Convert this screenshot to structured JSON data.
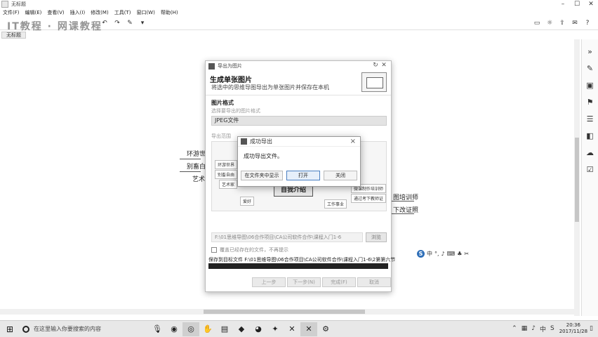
{
  "window": {
    "title": "无标题",
    "controls": [
      "–",
      "☐",
      "✕"
    ]
  },
  "menu": [
    "文件(F)",
    "编辑(E)",
    "查看(V)",
    "插入(I)",
    "修改(M)",
    "工具(T)",
    "窗口(W)",
    "帮助(H)"
  ],
  "toolbar_watermark": "IT教程 · 网课教程",
  "document_tab": "无标题",
  "background_nodes": {
    "n1": "环游世界",
    "n2": "别畜白台",
    "n3": "艺术家",
    "n4": "图培训师",
    "n5": "下改证照"
  },
  "export_dialog": {
    "title": "导出为图片",
    "heading": "生成单张图片",
    "description": "将选中的思维导图导出为单张图片并保存在本机",
    "format_label": "图片格式",
    "format_hint": "选择要导出的图片格式",
    "format_value": "JPEG文件",
    "range_label": "导出范围",
    "preview": {
      "nodes": [
        "环游世界",
        "别畜自由",
        "艺术家",
        "爱好",
        "工作事业",
        "微课制作培训师",
        "通过考下教师证"
      ],
      "center": "自我介绍"
    },
    "path_value": "F:\\01思维导图\\06合作项目\\CA公司软件合作\\课程入门1-6",
    "browse_label": "浏览",
    "overwrite_label": "覆盖已经存在的文件，不再提示",
    "saved_text": "保存到目标文件 F:\\01思维导图\\06合作项目\\CA公司软件合作\\课程入门1-6\\2第第六节",
    "progress": 1.0,
    "buttons": [
      "上一步",
      "下一步(N)",
      "完成(F)",
      "取消"
    ]
  },
  "success_dialog": {
    "title": "成功导出",
    "message": "成功导出文件。",
    "btn_show_in_folder": "在文件夹中显示",
    "btn_open": "打开",
    "btn_close": "关闭"
  },
  "taskbar": {
    "search_placeholder": "在这里输入你要搜索的内容",
    "time": "20:36",
    "date": "2017/11/28",
    "ime": "中"
  }
}
